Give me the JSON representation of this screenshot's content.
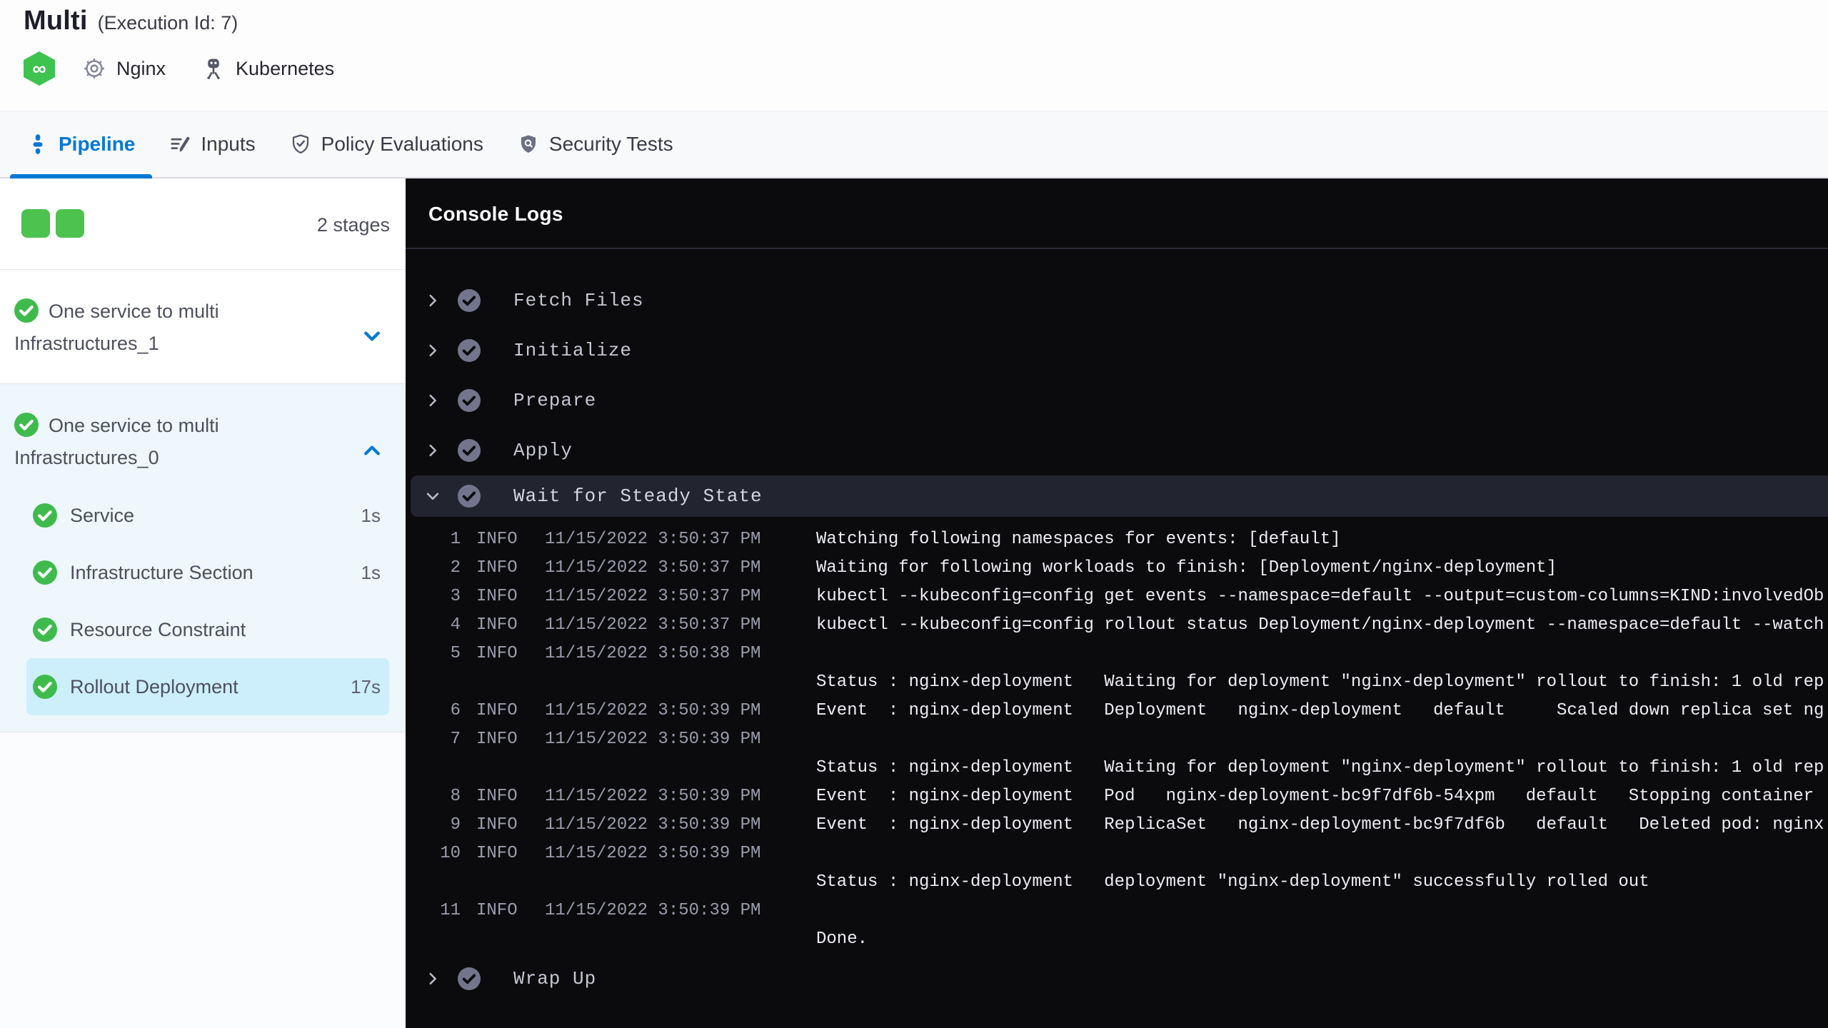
{
  "header": {
    "title": "Multi",
    "execution_id": "(Execution Id: 7)",
    "service_label": "Nginx",
    "infrastructure_label": "Kubernetes"
  },
  "tabs": [
    {
      "label": "Pipeline",
      "active": true
    },
    {
      "label": "Inputs",
      "active": false
    },
    {
      "label": "Policy Evaluations",
      "active": false
    },
    {
      "label": "Security Tests",
      "active": false
    }
  ],
  "sidebar": {
    "stage_count": "2 stages",
    "stages": [
      {
        "name": "One service to multi Infrastructures_1",
        "status": "success",
        "expanded": false
      },
      {
        "name": "One service to multi Infrastructures_0",
        "status": "success",
        "expanded": true,
        "steps": [
          {
            "name": "Service",
            "duration": "1s",
            "status": "success",
            "selected": false
          },
          {
            "name": "Infrastructure Section",
            "duration": "1s",
            "status": "success",
            "selected": false
          },
          {
            "name": "Resource Constraint",
            "duration": "",
            "status": "success",
            "selected": false
          },
          {
            "name": "Rollout Deployment",
            "duration": "17s",
            "status": "success",
            "selected": true
          }
        ]
      }
    ]
  },
  "console": {
    "title": "Console Logs",
    "steps": [
      {
        "label": "Fetch Files",
        "state": "collapsed",
        "status": "success"
      },
      {
        "label": "Initialize",
        "state": "collapsed",
        "status": "success"
      },
      {
        "label": "Prepare",
        "state": "collapsed",
        "status": "success"
      },
      {
        "label": "Apply",
        "state": "collapsed",
        "status": "success"
      },
      {
        "label": "Wait for Steady State",
        "state": "expanded",
        "status": "success"
      },
      {
        "label": "Wrap Up",
        "state": "collapsed",
        "status": "success"
      }
    ],
    "logs": [
      {
        "num": "1",
        "level": "INFO",
        "time": "11/15/2022 3:50:37 PM",
        "msg": "Watching following namespaces for events: [default]"
      },
      {
        "num": "2",
        "level": "INFO",
        "time": "11/15/2022 3:50:37 PM",
        "msg": "Waiting for following workloads to finish: [Deployment/nginx-deployment]"
      },
      {
        "num": "3",
        "level": "INFO",
        "time": "11/15/2022 3:50:37 PM",
        "msg": "kubectl --kubeconfig=config get events --namespace=default --output=custom-columns=KIND:involvedOb"
      },
      {
        "num": "4",
        "level": "INFO",
        "time": "11/15/2022 3:50:37 PM",
        "msg": "kubectl --kubeconfig=config rollout status Deployment/nginx-deployment --namespace=default --watch"
      },
      {
        "num": "5",
        "level": "INFO",
        "time": "11/15/2022 3:50:38 PM",
        "msg": ""
      },
      {
        "num": "",
        "level": "",
        "time": "",
        "msg": "Status : nginx-deployment   Waiting for deployment \"nginx-deployment\" rollout to finish: 1 old rep"
      },
      {
        "num": "6",
        "level": "INFO",
        "time": "11/15/2022 3:50:39 PM",
        "msg": "Event  : nginx-deployment   Deployment   nginx-deployment   default     Scaled down replica set ng"
      },
      {
        "num": "7",
        "level": "INFO",
        "time": "11/15/2022 3:50:39 PM",
        "msg": ""
      },
      {
        "num": "",
        "level": "",
        "time": "",
        "msg": "Status : nginx-deployment   Waiting for deployment \"nginx-deployment\" rollout to finish: 1 old rep"
      },
      {
        "num": "8",
        "level": "INFO",
        "time": "11/15/2022 3:50:39 PM",
        "msg": "Event  : nginx-deployment   Pod   nginx-deployment-bc9f7df6b-54xpm   default   Stopping container"
      },
      {
        "num": "9",
        "level": "INFO",
        "time": "11/15/2022 3:50:39 PM",
        "msg": "Event  : nginx-deployment   ReplicaSet   nginx-deployment-bc9f7df6b   default   Deleted pod: nginx"
      },
      {
        "num": "10",
        "level": "INFO",
        "time": "11/15/2022 3:50:39 PM",
        "msg": ""
      },
      {
        "num": "",
        "level": "",
        "time": "",
        "msg": "Status : nginx-deployment   deployment \"nginx-deployment\" successfully rolled out"
      },
      {
        "num": "11",
        "level": "INFO",
        "time": "11/15/2022 3:50:39 PM",
        "msg": ""
      },
      {
        "num": "",
        "level": "",
        "time": "",
        "msg": "Done."
      }
    ]
  },
  "colors": {
    "accent_blue": "#0278d5",
    "success_green": "#4cc24f",
    "console_bg": "#0b0b0d",
    "console_highlight": "#222430",
    "expanded_stage_bg": "#edf7fc",
    "selected_step_bg": "#cdeefb"
  },
  "icons": {
    "brand": "harness-infinity-icon",
    "service": "gear-icon",
    "infrastructure": "kubernetes-icon"
  }
}
